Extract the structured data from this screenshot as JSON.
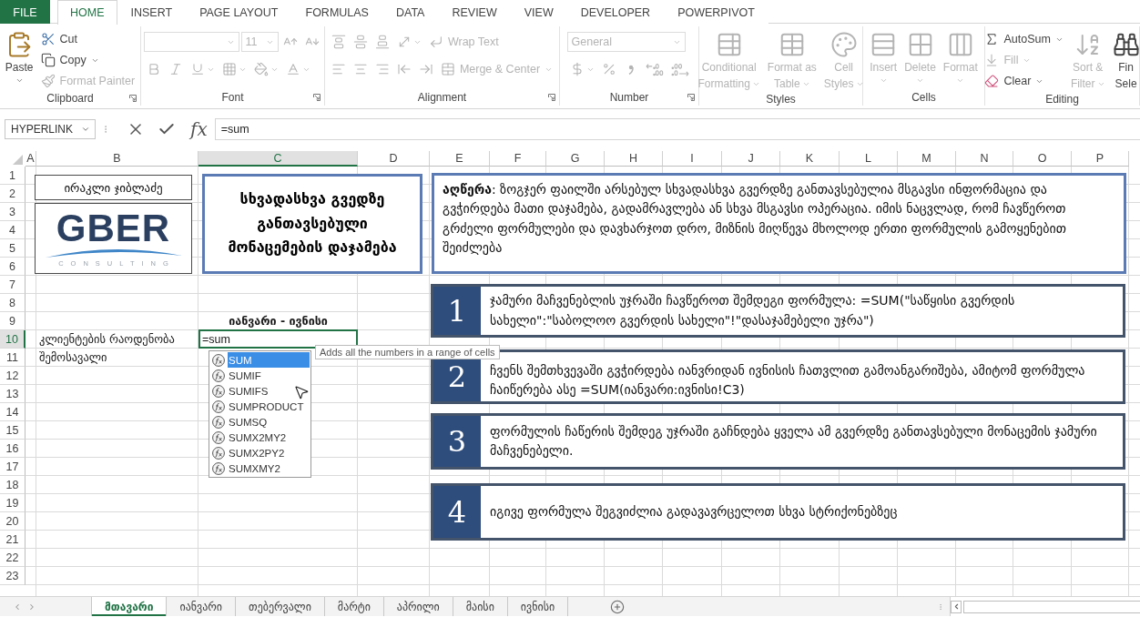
{
  "ribbon": {
    "tabs": [
      {
        "label": "FILE",
        "kind": "file",
        "selected": false
      },
      {
        "label": "HOME",
        "kind": "tab",
        "selected": true
      },
      {
        "label": "INSERT",
        "kind": "tab",
        "selected": false
      },
      {
        "label": "PAGE LAYOUT",
        "kind": "tab",
        "selected": false
      },
      {
        "label": "FORMULAS",
        "kind": "tab",
        "selected": false
      },
      {
        "label": "DATA",
        "kind": "tab",
        "selected": false
      },
      {
        "label": "REVIEW",
        "kind": "tab",
        "selected": false
      },
      {
        "label": "VIEW",
        "kind": "tab",
        "selected": false
      },
      {
        "label": "DEVELOPER",
        "kind": "tab",
        "selected": false
      },
      {
        "label": "POWERPIVOT",
        "kind": "tab",
        "selected": false
      }
    ],
    "groups": [
      {
        "label": "Clipboard",
        "launcher": true,
        "items": [
          {
            "kind": "large",
            "lines": [
              "Paste"
            ],
            "dropdown": true,
            "disabled": false
          },
          {
            "kind": "small",
            "label": "Cut",
            "dropdown": false,
            "disabled": false
          },
          {
            "kind": "small",
            "label": "Copy",
            "dropdown": true,
            "disabled": false
          },
          {
            "kind": "small",
            "label": "Format Painter",
            "dropdown": false,
            "disabled": true
          }
        ]
      },
      {
        "label": "Font",
        "launcher": true,
        "rows": [
          [
            {
              "kind": "field",
              "dropdown": true,
              "disabled": true
            },
            {
              "kind": "field",
              "value": "11",
              "dropdown": true,
              "disabled": true
            },
            {
              "kind": "icon",
              "dropdown": false,
              "disabled": true
            },
            {
              "kind": "icon",
              "dropdown": false,
              "disabled": true
            }
          ],
          [
            {
              "kind": "icon",
              "dropdown": false,
              "disabled": true
            },
            {
              "kind": "icon",
              "dropdown": false,
              "disabled": true
            },
            {
              "kind": "icon",
              "dropdown": true,
              "disabled": true
            },
            {
              "kind": "icon",
              "dropdown": true,
              "disabled": true
            },
            {
              "kind": "icon",
              "dropdown": true,
              "disabled": true
            },
            {
              "kind": "icon",
              "dropdown": true,
              "disabled": true
            }
          ]
        ]
      },
      {
        "label": "Alignment",
        "launcher": true,
        "rows": [
          [
            {
              "kind": "icon",
              "dropdown": false,
              "disabled": true
            },
            {
              "kind": "icon",
              "dropdown": false,
              "disabled": true
            },
            {
              "kind": "icon",
              "dropdown": false,
              "disabled": true
            },
            {
              "kind": "icon",
              "dropdown": true,
              "disabled": true
            },
            {
              "kind": "small",
              "label": "Wrap Text",
              "dropdown": false,
              "disabled": true
            }
          ],
          [
            {
              "kind": "icon",
              "dropdown": false,
              "disabled": true
            },
            {
              "kind": "icon",
              "dropdown": false,
              "disabled": true
            },
            {
              "kind": "icon",
              "dropdown": false,
              "disabled": true
            },
            {
              "kind": "icon",
              "dropdown": false,
              "disabled": true
            },
            {
              "kind": "icon",
              "dropdown": false,
              "disabled": true
            },
            {
              "kind": "small",
              "label": "Merge & Center",
              "dropdown": true,
              "disabled": true
            }
          ]
        ]
      },
      {
        "label": "Number",
        "launcher": true,
        "rows": [
          [
            {
              "kind": "field",
              "value": "General",
              "dropdown": true,
              "disabled": true
            }
          ],
          [
            {
              "kind": "icon",
              "dropdown": true,
              "disabled": true
            },
            {
              "kind": "icon",
              "dropdown": false,
              "disabled": true
            },
            {
              "kind": "icon",
              "dropdown": false,
              "disabled": true
            },
            {
              "kind": "icon",
              "dropdown": false,
              "disabled": true
            },
            {
              "kind": "icon",
              "dropdown": false,
              "disabled": true
            }
          ]
        ]
      },
      {
        "label": "Styles",
        "launcher": false,
        "items": [
          {
            "kind": "large",
            "lines": [
              "Conditional",
              "Formatting"
            ],
            "dropdown": true,
            "disabled": true
          },
          {
            "kind": "large",
            "lines": [
              "Format as",
              "Table"
            ],
            "dropdown": true,
            "disabled": true
          },
          {
            "kind": "large",
            "lines": [
              "Cell",
              "Styles"
            ],
            "dropdown": true,
            "disabled": true
          }
        ]
      },
      {
        "label": "Cells",
        "launcher": false,
        "items": [
          {
            "kind": "large",
            "lines": [
              "Insert"
            ],
            "dropdown": true,
            "disabled": true
          },
          {
            "kind": "large",
            "lines": [
              "Delete"
            ],
            "dropdown": true,
            "disabled": true
          },
          {
            "kind": "large",
            "lines": [
              "Format"
            ],
            "dropdown": true,
            "disabled": true
          }
        ]
      },
      {
        "label": "Editing",
        "launcher": false,
        "items": [
          {
            "kind": "small",
            "label": "AutoSum",
            "dropdown": true,
            "disabled": false
          },
          {
            "kind": "small",
            "label": "Fill",
            "dropdown": true,
            "disabled": true
          },
          {
            "kind": "small",
            "label": "Clear",
            "dropdown": true,
            "disabled": false
          },
          {
            "kind": "large",
            "lines": [
              "Sort &",
              "Filter"
            ],
            "dropdown": true,
            "disabled": true
          },
          {
            "kind": "large",
            "lines": [
              "Fin",
              "Sele"
            ],
            "dropdown": false,
            "disabled": false
          }
        ]
      }
    ]
  },
  "formula_bar": {
    "name_box": "HYPERLINK",
    "function_button": "fx",
    "formula": "=sum"
  },
  "sheet": {
    "columns": [
      {
        "label": "A",
        "selected": false
      },
      {
        "label": "B",
        "selected": false
      },
      {
        "label": "C",
        "selected": true
      },
      {
        "label": "D",
        "selected": false
      },
      {
        "label": "E",
        "selected": false
      },
      {
        "label": "F",
        "selected": false
      },
      {
        "label": "G",
        "selected": false
      },
      {
        "label": "H",
        "selected": false
      },
      {
        "label": "I",
        "selected": false
      },
      {
        "label": "J",
        "selected": false
      },
      {
        "label": "K",
        "selected": false
      },
      {
        "label": "L",
        "selected": false
      },
      {
        "label": "M",
        "selected": false
      },
      {
        "label": "N",
        "selected": false
      },
      {
        "label": "O",
        "selected": false
      },
      {
        "label": "P",
        "selected": false
      }
    ],
    "rows": [
      {
        "label": "1",
        "selected": false
      },
      {
        "label": "2",
        "selected": false
      },
      {
        "label": "3",
        "selected": false
      },
      {
        "label": "4",
        "selected": false
      },
      {
        "label": "5",
        "selected": false
      },
      {
        "label": "6",
        "selected": false
      },
      {
        "label": "7",
        "selected": false
      },
      {
        "label": "8",
        "selected": false
      },
      {
        "label": "9",
        "selected": false,
        "cells": {
          "C": {
            "text": "იანვარი - ივნისი",
            "bold": true,
            "editing": false
          }
        }
      },
      {
        "label": "10",
        "selected": true,
        "cells": {
          "B": {
            "text": "კლიენტების რაოდენობა",
            "bold": false,
            "editing": false
          },
          "C": {
            "text": "=sum",
            "bold": false,
            "editing": true
          }
        }
      },
      {
        "label": "11",
        "selected": false,
        "cells": {
          "B": {
            "text": "შემოსავალი",
            "bold": false,
            "editing": false
          }
        }
      },
      {
        "label": "12",
        "selected": false
      },
      {
        "label": "13",
        "selected": false
      },
      {
        "label": "14",
        "selected": false
      },
      {
        "label": "15",
        "selected": false
      },
      {
        "label": "16",
        "selected": false
      },
      {
        "label": "17",
        "selected": false
      },
      {
        "label": "18",
        "selected": false
      },
      {
        "label": "19",
        "selected": false
      },
      {
        "label": "20",
        "selected": false
      },
      {
        "label": "21",
        "selected": false
      },
      {
        "label": "22",
        "selected": false
      },
      {
        "label": "23",
        "selected": false
      }
    ],
    "shapes": [
      {
        "kind": "label",
        "text": "ირაკლი ჯიბლაძე"
      },
      {
        "kind": "logo",
        "name": "GBER",
        "tagline": "CONSULTING"
      },
      {
        "kind": "title",
        "text": "სხვადასხვა გვედზე განთავსებული მონაცემების დაჯამება"
      },
      {
        "kind": "description",
        "text": "**აღწერა**: ზოგჯერ ფაილში არსებულ სხვადასხვა გვერდზე განთავსებულია მსგავსი ინფორმაცია და გვჭირდება მათი დაჯამება, გადამრავლება ან სხვა მსგავსი ოპერაცია. იმის ნაცვლად, რომ ჩავწეროთ გრძელი ფორმულები და დავხარჯოთ დრო, მიზნის მიღწევა მხოლოდ ერთი ფორმულის გამოყენებით შეიძლება"
      },
      {
        "kind": "step",
        "number": "1",
        "text": "ჯამური მაჩვენებლის უჯრაში ჩავწეროთ შემდეგი ფორმულა: =SUM(\"საწყისი გვერდის სახელი\":\"საბოლოო გვერდის სახელი\"!\"დასაჯამებელი უჯრა\")"
      },
      {
        "kind": "step",
        "number": "2",
        "text": "ჩვენს შემთხვევაში გვჭირდება იანვრიდან ივნისის ჩათვლით გამოანგარიშება, ამიტომ ფორმულა ჩაიწერება ასე =SUM(იანვარი:ივნისი!C3)"
      },
      {
        "kind": "step",
        "number": "3",
        "text": "ფორმულის ჩაწერის შემდეგ უჯრაში გაჩნდება ყველა ამ გვერდზე განთავსებული მონაცემის ჯამური მაჩვენებელი."
      },
      {
        "kind": "step",
        "number": "4",
        "text": "იგივე ფორმულა შეგვიძლია გადავავრცელოთ სხვა სტრიქონებზეც"
      }
    ]
  },
  "autocomplete": {
    "items": [
      {
        "label": "SUM",
        "selected": true
      },
      {
        "label": "SUMIF",
        "selected": false
      },
      {
        "label": "SUMIFS",
        "selected": false
      },
      {
        "label": "SUMPRODUCT",
        "selected": false
      },
      {
        "label": "SUMSQ",
        "selected": false
      },
      {
        "label": "SUMX2MY2",
        "selected": false
      },
      {
        "label": "SUMX2PY2",
        "selected": false
      },
      {
        "label": "SUMXMY2",
        "selected": false
      }
    ],
    "tooltip": "Adds all the numbers in a range of cells"
  },
  "sheet_tabs": [
    {
      "label": "მთავარი",
      "selected": true
    },
    {
      "label": "იანვარი",
      "selected": false
    },
    {
      "label": "თებერვალი",
      "selected": false
    },
    {
      "label": "მარტი",
      "selected": false
    },
    {
      "label": "აპრილი",
      "selected": false
    },
    {
      "label": "მაისი",
      "selected": false
    },
    {
      "label": "ივნისი",
      "selected": false
    }
  ]
}
